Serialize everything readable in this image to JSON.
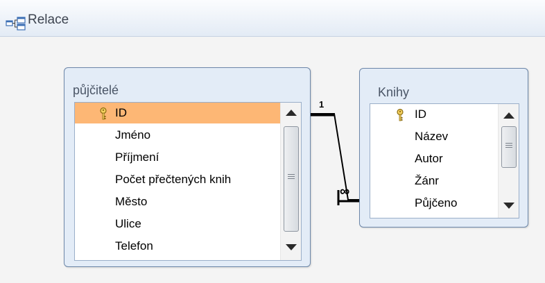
{
  "tab": {
    "title": "Relace",
    "icon": "relationships-icon"
  },
  "tables": {
    "pujcitele": {
      "title": "půjčitelé",
      "fields": [
        {
          "name": "ID",
          "primary_key": true,
          "selected": true
        },
        {
          "name": "Jméno"
        },
        {
          "name": "Příjmení"
        },
        {
          "name": "Počet přečtených knih"
        },
        {
          "name": "Město"
        },
        {
          "name": "Ulice"
        },
        {
          "name": "Telefon"
        }
      ]
    },
    "knihy": {
      "title": "Knihy",
      "fields": [
        {
          "name": "ID",
          "primary_key": true
        },
        {
          "name": "Název"
        },
        {
          "name": "Autor"
        },
        {
          "name": "Žánr"
        },
        {
          "name": "Půjčeno"
        }
      ]
    }
  },
  "relationship": {
    "one_label": "1",
    "many_label": "∞"
  },
  "colors": {
    "selection": "#fdb775",
    "table_header": "#e3ecf7",
    "table_border": "#6c86a8",
    "key": "#e0b030"
  }
}
